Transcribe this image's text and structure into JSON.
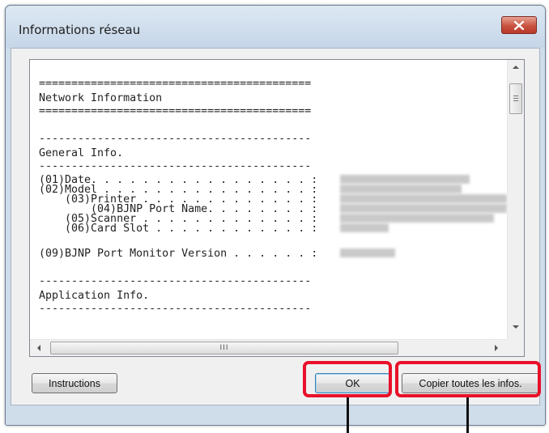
{
  "window": {
    "title": "Informations réseau"
  },
  "network_info": {
    "lines": [
      "==========================================",
      "Network Information",
      "==========================================",
      "",
      "------------------------------------------",
      "General Info.",
      "------------------------------------------",
      "(01)Date. . . . . . . . . . . . . . . . . :",
      "(02)Model . . . . . . . . . . . . . . . . :",
      "    (03)Printer . . . . . . . . . . . . . :",
      "        (04)BJNP Port Name. . . . . . . . :",
      "    (05)Scanner . . . . . . . . . . . . . :",
      "    (06)Card Slot . . . . . . . . . . . . :",
      "",
      "(09)BJNP Port Monitor Version . . . . . . :",
      "",
      "------------------------------------------",
      "Application Info.",
      "------------------------------------------"
    ]
  },
  "buttons": {
    "instructions": "Instructions",
    "ok": "OK",
    "copy_all": "Copier toutes les infos."
  },
  "scrollbar": {
    "h_thumb_grip": "III"
  },
  "colors": {
    "highlight": "#e8102a",
    "close_button": "#c9523f",
    "window_frame": "#cfdcea"
  }
}
